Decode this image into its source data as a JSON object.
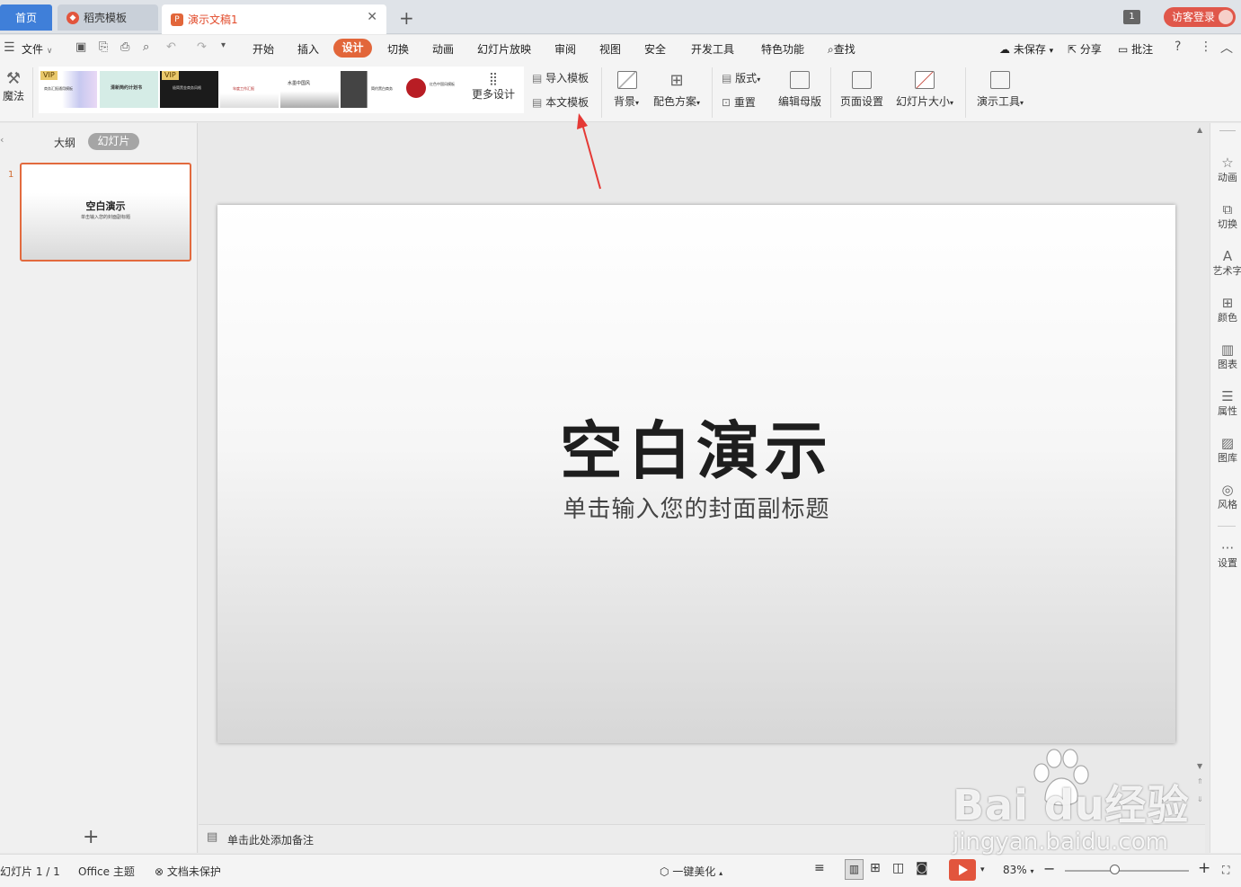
{
  "tabs": {
    "home": "首页",
    "docer": "稻壳模板",
    "doc": "演示文稿1",
    "close": "✕",
    "add": "+"
  },
  "window": {
    "badge": "1",
    "login": "访客登录"
  },
  "menu": {
    "file": "文件",
    "items": [
      "开始",
      "插入",
      "设计",
      "切换",
      "动画",
      "幻灯片放映",
      "审阅",
      "视图",
      "安全",
      "开发工具",
      "特色功能"
    ],
    "find": "查找",
    "unsaved": "未保存",
    "share": "分享",
    "comment": "批注"
  },
  "ribbon": {
    "magic": "魔法",
    "vip": "VIP",
    "more_design": "更多设计",
    "import_template": "导入模板",
    "this_template": "本文模板",
    "background": "背景",
    "color_scheme": "配色方案",
    "layout": "版式",
    "reset": "重置",
    "edit_master": "编辑母版",
    "page_setup": "页面设置",
    "slide_size": "幻灯片大小",
    "present_tools": "演示工具",
    "thumb_titles": [
      "商务汇报通用模板",
      "清新简约计划书",
      "极简黑金商务风格",
      "年度工作汇报",
      "水墨中国风",
      "简约黑白商务",
      "红色中国风模板"
    ]
  },
  "left_panel": {
    "outline_tab": "大纲",
    "slides_tab": "幻灯片",
    "slide_number": "1",
    "thumb_title": "空白演示",
    "thumb_subtitle": "单击输入您的封面副标题"
  },
  "slide": {
    "title": "空白演示",
    "subtitle": "单击输入您的封面副标题"
  },
  "notes": {
    "placeholder": "单击此处添加备注"
  },
  "right_sidebar": [
    "动画",
    "切换",
    "艺术字",
    "颜色",
    "图表",
    "属性",
    "图库",
    "风格",
    "设置"
  ],
  "status": {
    "slide_counter": "幻灯片 1 / 1",
    "theme": "Office 主题",
    "protect": "文档未保护",
    "beautify": "一键美化",
    "zoom": "83%"
  },
  "watermark": {
    "main": "Bai  du经验",
    "url": "jingyan.baidu.com"
  },
  "colors": {
    "accent": "#e2663a",
    "home_tab": "#3f7fd9",
    "arrow": "#e53935"
  }
}
